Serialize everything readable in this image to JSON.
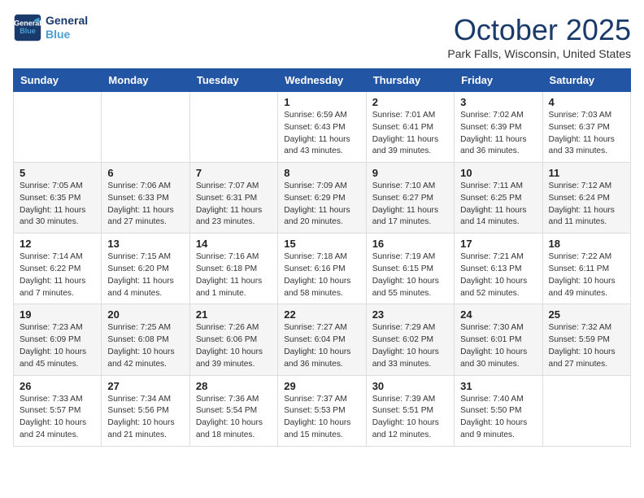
{
  "header": {
    "logo_line1": "General",
    "logo_line2": "Blue",
    "month": "October 2025",
    "location": "Park Falls, Wisconsin, United States"
  },
  "weekdays": [
    "Sunday",
    "Monday",
    "Tuesday",
    "Wednesday",
    "Thursday",
    "Friday",
    "Saturday"
  ],
  "weeks": [
    [
      {
        "day": "",
        "info": ""
      },
      {
        "day": "",
        "info": ""
      },
      {
        "day": "",
        "info": ""
      },
      {
        "day": "1",
        "info": "Sunrise: 6:59 AM\nSunset: 6:43 PM\nDaylight: 11 hours\nand 43 minutes."
      },
      {
        "day": "2",
        "info": "Sunrise: 7:01 AM\nSunset: 6:41 PM\nDaylight: 11 hours\nand 39 minutes."
      },
      {
        "day": "3",
        "info": "Sunrise: 7:02 AM\nSunset: 6:39 PM\nDaylight: 11 hours\nand 36 minutes."
      },
      {
        "day": "4",
        "info": "Sunrise: 7:03 AM\nSunset: 6:37 PM\nDaylight: 11 hours\nand 33 minutes."
      }
    ],
    [
      {
        "day": "5",
        "info": "Sunrise: 7:05 AM\nSunset: 6:35 PM\nDaylight: 11 hours\nand 30 minutes."
      },
      {
        "day": "6",
        "info": "Sunrise: 7:06 AM\nSunset: 6:33 PM\nDaylight: 11 hours\nand 27 minutes."
      },
      {
        "day": "7",
        "info": "Sunrise: 7:07 AM\nSunset: 6:31 PM\nDaylight: 11 hours\nand 23 minutes."
      },
      {
        "day": "8",
        "info": "Sunrise: 7:09 AM\nSunset: 6:29 PM\nDaylight: 11 hours\nand 20 minutes."
      },
      {
        "day": "9",
        "info": "Sunrise: 7:10 AM\nSunset: 6:27 PM\nDaylight: 11 hours\nand 17 minutes."
      },
      {
        "day": "10",
        "info": "Sunrise: 7:11 AM\nSunset: 6:25 PM\nDaylight: 11 hours\nand 14 minutes."
      },
      {
        "day": "11",
        "info": "Sunrise: 7:12 AM\nSunset: 6:24 PM\nDaylight: 11 hours\nand 11 minutes."
      }
    ],
    [
      {
        "day": "12",
        "info": "Sunrise: 7:14 AM\nSunset: 6:22 PM\nDaylight: 11 hours\nand 7 minutes."
      },
      {
        "day": "13",
        "info": "Sunrise: 7:15 AM\nSunset: 6:20 PM\nDaylight: 11 hours\nand 4 minutes."
      },
      {
        "day": "14",
        "info": "Sunrise: 7:16 AM\nSunset: 6:18 PM\nDaylight: 11 hours\nand 1 minute."
      },
      {
        "day": "15",
        "info": "Sunrise: 7:18 AM\nSunset: 6:16 PM\nDaylight: 10 hours\nand 58 minutes."
      },
      {
        "day": "16",
        "info": "Sunrise: 7:19 AM\nSunset: 6:15 PM\nDaylight: 10 hours\nand 55 minutes."
      },
      {
        "day": "17",
        "info": "Sunrise: 7:21 AM\nSunset: 6:13 PM\nDaylight: 10 hours\nand 52 minutes."
      },
      {
        "day": "18",
        "info": "Sunrise: 7:22 AM\nSunset: 6:11 PM\nDaylight: 10 hours\nand 49 minutes."
      }
    ],
    [
      {
        "day": "19",
        "info": "Sunrise: 7:23 AM\nSunset: 6:09 PM\nDaylight: 10 hours\nand 45 minutes."
      },
      {
        "day": "20",
        "info": "Sunrise: 7:25 AM\nSunset: 6:08 PM\nDaylight: 10 hours\nand 42 minutes."
      },
      {
        "day": "21",
        "info": "Sunrise: 7:26 AM\nSunset: 6:06 PM\nDaylight: 10 hours\nand 39 minutes."
      },
      {
        "day": "22",
        "info": "Sunrise: 7:27 AM\nSunset: 6:04 PM\nDaylight: 10 hours\nand 36 minutes."
      },
      {
        "day": "23",
        "info": "Sunrise: 7:29 AM\nSunset: 6:02 PM\nDaylight: 10 hours\nand 33 minutes."
      },
      {
        "day": "24",
        "info": "Sunrise: 7:30 AM\nSunset: 6:01 PM\nDaylight: 10 hours\nand 30 minutes."
      },
      {
        "day": "25",
        "info": "Sunrise: 7:32 AM\nSunset: 5:59 PM\nDaylight: 10 hours\nand 27 minutes."
      }
    ],
    [
      {
        "day": "26",
        "info": "Sunrise: 7:33 AM\nSunset: 5:57 PM\nDaylight: 10 hours\nand 24 minutes."
      },
      {
        "day": "27",
        "info": "Sunrise: 7:34 AM\nSunset: 5:56 PM\nDaylight: 10 hours\nand 21 minutes."
      },
      {
        "day": "28",
        "info": "Sunrise: 7:36 AM\nSunset: 5:54 PM\nDaylight: 10 hours\nand 18 minutes."
      },
      {
        "day": "29",
        "info": "Sunrise: 7:37 AM\nSunset: 5:53 PM\nDaylight: 10 hours\nand 15 minutes."
      },
      {
        "day": "30",
        "info": "Sunrise: 7:39 AM\nSunset: 5:51 PM\nDaylight: 10 hours\nand 12 minutes."
      },
      {
        "day": "31",
        "info": "Sunrise: 7:40 AM\nSunset: 5:50 PM\nDaylight: 10 hours\nand 9 minutes."
      },
      {
        "day": "",
        "info": ""
      }
    ]
  ]
}
